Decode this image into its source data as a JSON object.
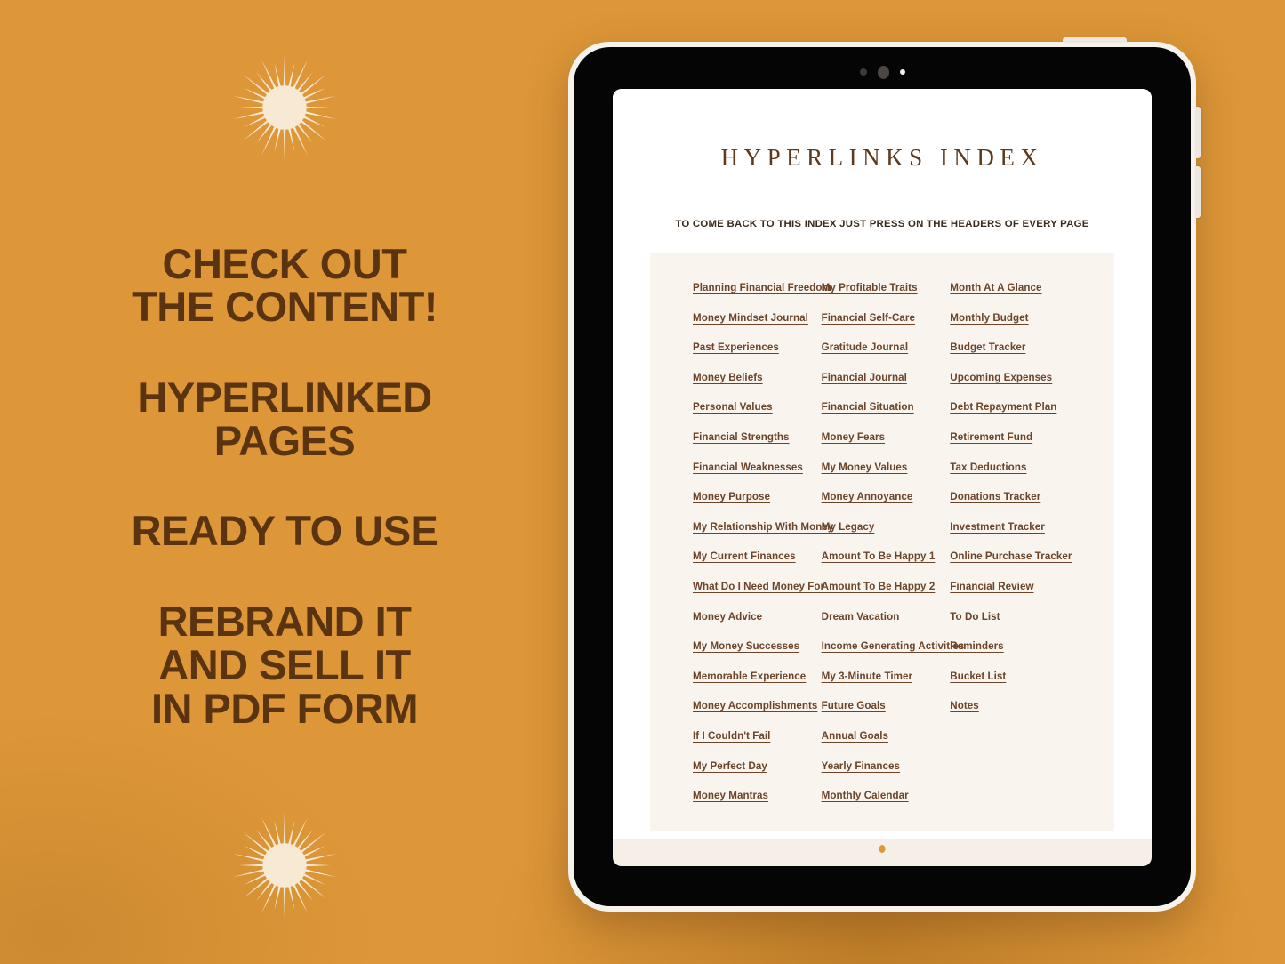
{
  "theme": {
    "background_orange": "#DD9738",
    "promo_text_brown": "#5A3311",
    "link_brown": "#6B4529",
    "panel_cream": "#FAF4EE",
    "screen_cream": "#F6EFE8",
    "title_brown": "#5C3A1E"
  },
  "promo": {
    "blocks": [
      {
        "lines": [
          "CHECK OUT",
          "THE CONTENT!"
        ]
      },
      {
        "lines": [
          "HYPERLINKED",
          "PAGES"
        ]
      },
      {
        "lines": [
          "READY TO USE"
        ]
      },
      {
        "lines": [
          "REBRAND IT",
          "AND SELL IT",
          "IN PDF FORM"
        ]
      }
    ]
  },
  "document": {
    "title": "HYPERLINKS INDEX",
    "subtitle": "TO COME BACK TO THIS INDEX JUST PRESS ON THE HEADERS OF EVERY PAGE",
    "columns": [
      [
        "Planning Financial Freedom",
        "Money Mindset Journal",
        "Past Experiences",
        "Money Beliefs",
        "Personal Values",
        "Financial Strengths",
        "Financial Weaknesses",
        "Money Purpose",
        "My Relationship With Money",
        "My Current Finances",
        "What Do I Need Money For",
        "Money Advice",
        "My Money Successes",
        "Memorable Experience",
        "Money Accomplishments",
        "If I Couldn't Fail",
        "My Perfect Day",
        "Money Mantras"
      ],
      [
        "My Profitable Traits",
        "Financial Self-Care",
        "Gratitude Journal",
        "Financial Journal",
        "Financial Situation",
        "Money Fears",
        "My Money Values",
        "Money Annoyance",
        "My Legacy",
        "Amount To Be Happy 1",
        "Amount To Be Happy 2",
        "Dream Vacation",
        "Income Generating Activities",
        "My 3-Minute Timer",
        "Future Goals",
        "Annual Goals",
        "Yearly Finances",
        "Monthly Calendar"
      ],
      [
        "Month At A Glance",
        "Monthly Budget",
        "Budget Tracker",
        "Upcoming Expenses",
        "Debt Repayment Plan",
        "Retirement Fund",
        "Tax Deductions",
        "Donations Tracker",
        "Investment Tracker",
        "Online Purchase Tracker",
        "Financial Review",
        "To Do List",
        "Reminders",
        "Bucket List",
        "Notes"
      ]
    ]
  },
  "device": {
    "icons": {
      "camera_1": "camera-dot-icon",
      "camera_2": "camera-lens-icon",
      "camera_3": "sensor-dot-icon",
      "home_indicator": "home-dot-icon",
      "volume_up": "volume-up-button",
      "volume_down": "volume-down-button",
      "power": "power-button"
    }
  },
  "decorations": {
    "sunburst_top": "sunburst-icon",
    "sunburst_bottom": "sunburst-icon",
    "sunburst_color": "#F7E9D4"
  }
}
